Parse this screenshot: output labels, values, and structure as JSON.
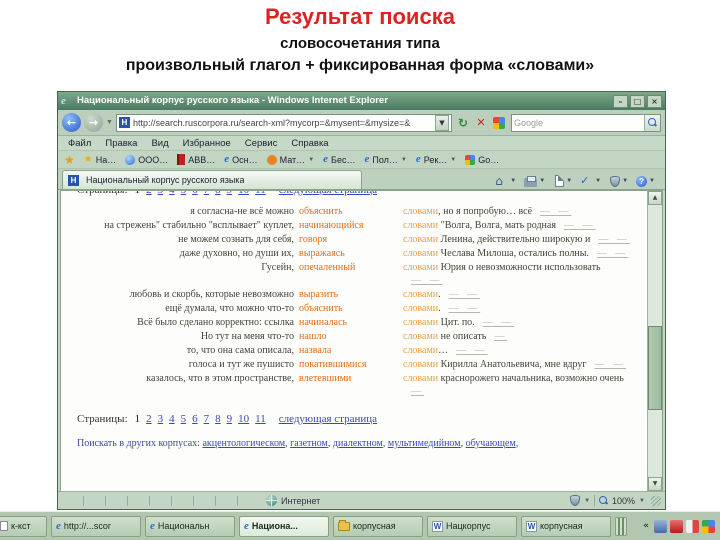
{
  "slide": {
    "title": "Результат поиска",
    "subtitle1": "словосочетания типа",
    "subtitle2": "произвольный глагол + фиксированная форма «словами»"
  },
  "window": {
    "title": "Национальный корпус русского языка - Windows Internet Explorer",
    "controls": {
      "minimize": "–",
      "maximize": "□",
      "close": "×"
    },
    "address": {
      "url": "http://search.ruscorpora.ru/search-xml?mycorp=&mysent=&mysize=&",
      "dropdown": "▼"
    },
    "search": {
      "value": "Google"
    },
    "menu": {
      "items": [
        "Файл",
        "Правка",
        "Вид",
        "Избранное",
        "Сервис",
        "Справка"
      ]
    },
    "favorites": {
      "items": [
        {
          "label": "На…",
          "icon": "star-icon",
          "caret": false
        },
        {
          "label": "ООО…",
          "icon": "globe-icon",
          "caret": false
        },
        {
          "label": "АВВ…",
          "icon": "book-icon",
          "caret": false
        },
        {
          "label": "Осн…",
          "icon": "ie-icon",
          "caret": false
        },
        {
          "label": "Мат…",
          "icon": "orange-icon",
          "caret": true
        },
        {
          "label": "Бес…",
          "icon": "ie-icon",
          "caret": false
        },
        {
          "label": "Пол…",
          "icon": "ie-icon",
          "caret": true
        },
        {
          "label": "Рек…",
          "icon": "ie-icon",
          "caret": true
        },
        {
          "label": "Go…",
          "icon": "google-icon",
          "caret": false
        }
      ]
    },
    "tab": {
      "title": "Национальный корпус русского языка"
    },
    "command_icons": [
      "home-icon",
      "print-icon",
      "page-icon",
      "check-icon",
      "shield-icon",
      "help-icon"
    ],
    "statusbar": {
      "zone": "Интернет",
      "zoom": "100%"
    }
  },
  "results": {
    "match_word": "словами",
    "rows": [
      {
        "left": "я согласна-не всё можно",
        "verb": "объяснить",
        "right": ", но я попробую… всё",
        "tail": "— —"
      },
      {
        "left": "на стрежень\" стабильно \"всплывает\" куплет,",
        "verb": "начинающийся",
        "right": " \"Волга, Волга, мать родная",
        "tail": "— —"
      },
      {
        "left": "не можем сознать для себя,",
        "verb": "говоря",
        "right": " Ленина, действительно широкую и",
        "tail": "— —"
      },
      {
        "left": "даже духовно, но души их,",
        "verb": "выражаясь",
        "right": " Чеслава Милоша, остались полны.",
        "tail": "— —"
      },
      {
        "left": "Гусейн,",
        "verb": "опечаленный",
        "right": " Юрия о невозможности использовать",
        "tail": "— —"
      },
      {
        "left": "любовь и скорбь, которые невозможно",
        "verb": "выразить",
        "right": ".",
        "tail": "— —"
      },
      {
        "left": "ещё думала, что можно что-то",
        "verb": "объяснить",
        "right": ".",
        "tail": "— —"
      },
      {
        "left": "Всё было сделано корректно: ссылка",
        "verb": "начиналась",
        "right": " Цит. по.",
        "tail": "— —"
      },
      {
        "left": "Но тут на меня что-то",
        "verb": "нашло",
        "right": " не описать",
        "tail": "—"
      },
      {
        "left": "то, что она сама описала,",
        "verb": "назвала",
        "right": "…",
        "tail": "— —"
      },
      {
        "left": "голоса и тут же пушисто",
        "verb": "покатившимися",
        "right": " Кирилла Анатольевича, мне вдруг",
        "tail": "— —"
      },
      {
        "left": "казалось, что в этом пространстве,",
        "verb": "влетевшими",
        "right": " краснорожего начальника, возможно очень",
        "tail": "—"
      }
    ],
    "pagination": {
      "label": "Страницы:",
      "current": "1",
      "pages": [
        "2",
        "3",
        "4",
        "5",
        "6",
        "7",
        "8",
        "9",
        "10",
        "11"
      ],
      "next": "следующая страница"
    },
    "corpora": {
      "prefix": "Поискать в других корпусах:",
      "links": [
        "акцентологическом",
        "газетном",
        "диалектном",
        "мультимедийном",
        "обучающем"
      ],
      "suffix": ","
    }
  },
  "taskbar": {
    "buttons": [
      {
        "label": "к-кст",
        "icon": "doc-icon",
        "active": false,
        "cut": true
      },
      {
        "label": "http://...scor",
        "icon": "ie-icon",
        "active": false,
        "cut": false
      },
      {
        "label": "Национальн",
        "icon": "ie-icon",
        "active": false,
        "cut": false
      },
      {
        "label": "Национа...",
        "icon": "ie-icon",
        "active": true,
        "cut": false
      },
      {
        "label": "корпусная",
        "icon": "folder-icon",
        "active": false,
        "cut": false
      },
      {
        "label": "Нацкорпус",
        "icon": "word-icon",
        "active": false,
        "cut": false
      },
      {
        "label": "корпусная",
        "icon": "word-icon",
        "active": false,
        "cut": false
      }
    ],
    "overflow_chevron": "«"
  }
}
